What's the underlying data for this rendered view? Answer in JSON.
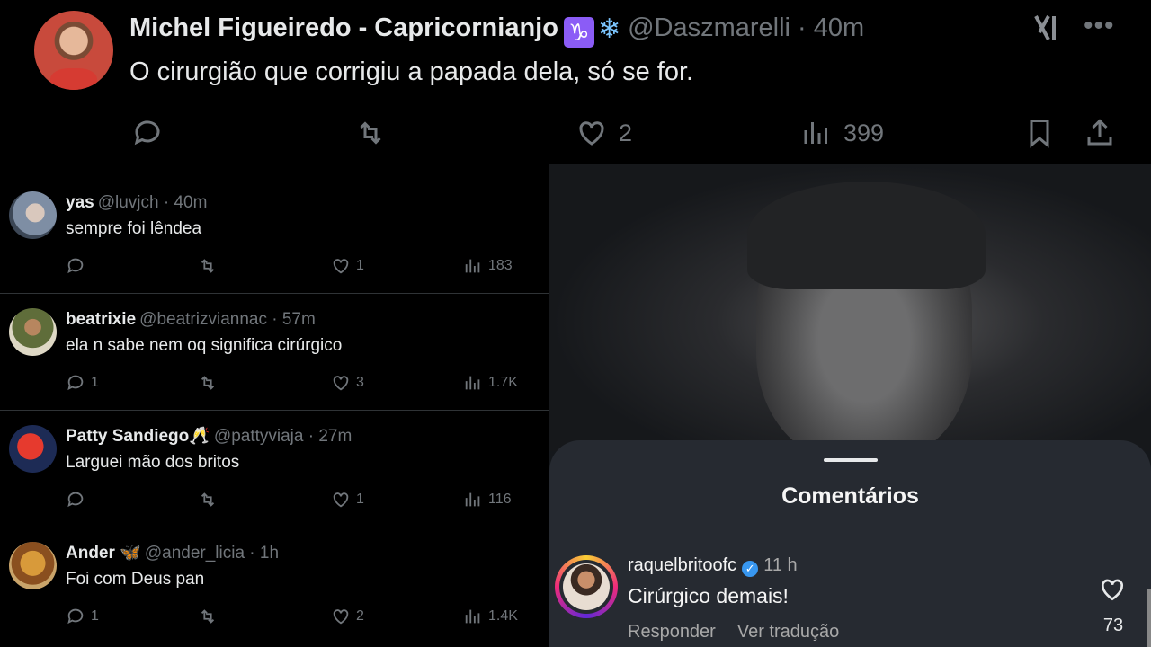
{
  "main_tweet": {
    "name": "Michel Figueiredo - Capricornianjo",
    "emoji1": "♑",
    "emoji2": "❄",
    "handle_time": "@Daszmarelli · 40m",
    "text": "O cirurgião que corrigiu a papada dela, só se for.",
    "likes": "2",
    "views": "399"
  },
  "replies": [
    {
      "name": "yas",
      "handle_time": "@luvjch · 40m",
      "text": "sempre foi lêndea",
      "replies": "",
      "likes": "1",
      "views": "183"
    },
    {
      "name": "beatrixie",
      "handle_time": "@beatrizviannac · 57m",
      "text": "ela n sabe nem oq significa cirúrgico",
      "replies": "1",
      "likes": "3",
      "views": "1.7K"
    },
    {
      "name": "Patty Sandiego🥂",
      "handle_time": "@pattyviaja · 27m",
      "text": "Larguei mão dos britos",
      "replies": "",
      "likes": "1",
      "views": "116"
    },
    {
      "name": "Ander 🦋",
      "handle_time": "@ander_licia · 1h",
      "text": "Foi com Deus pan",
      "replies": "1",
      "likes": "2",
      "views": "1.4K"
    }
  ],
  "comments_sheet": {
    "title": "Comentários",
    "user": "raquelbritoofc",
    "verified_mark": "✓",
    "time": "11 h",
    "text": "Cirúrgico demais!",
    "reply_label": "Responder",
    "translate_label": "Ver tradução",
    "likes": "73"
  },
  "icons": [
    "reply-icon",
    "retweet-icon",
    "heart-icon",
    "views-icon",
    "bookmark-icon",
    "share-icon",
    "grok-icon",
    "more-icon"
  ],
  "colors": {
    "background": "#000000",
    "muted": "#71767b",
    "sheet": "#262a31",
    "verified": "#3897f0"
  }
}
